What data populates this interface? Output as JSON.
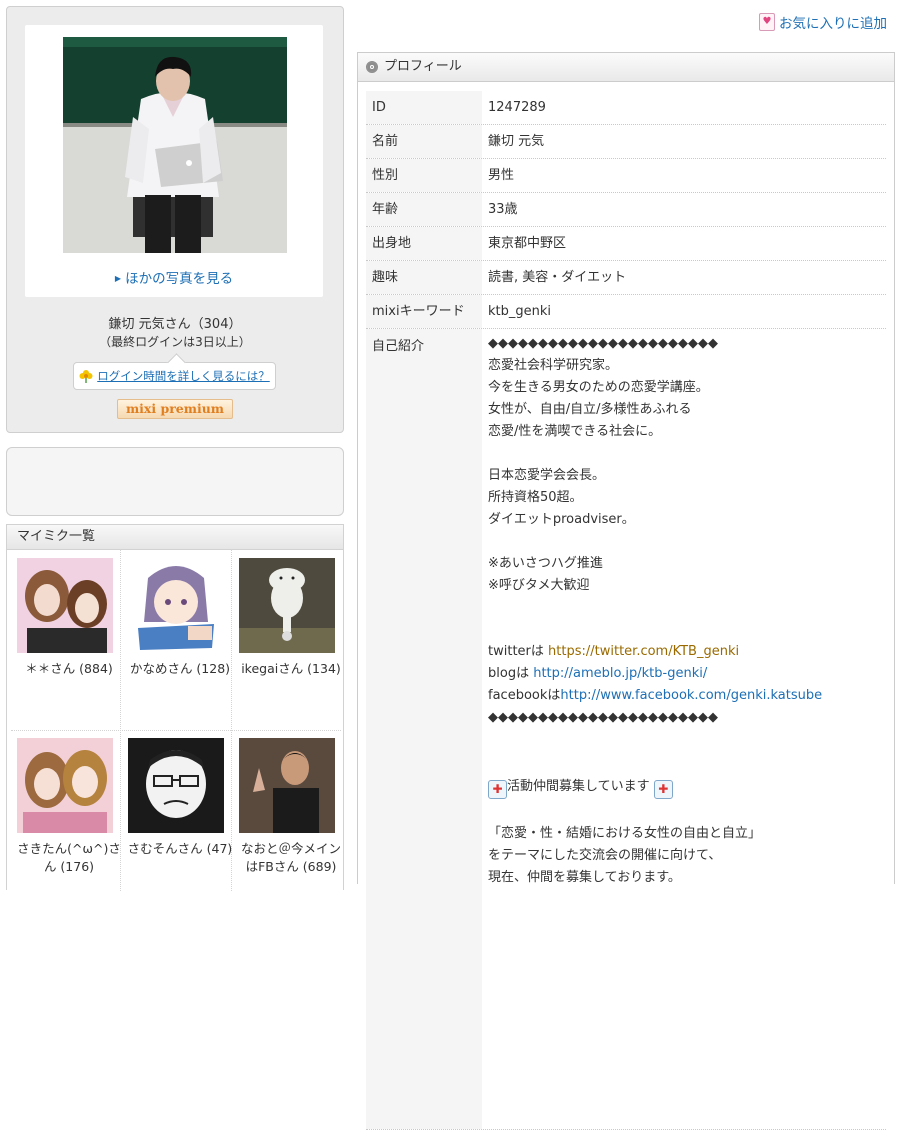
{
  "favorite": {
    "label": "お気に入りに追加",
    "icon": "heart-bookmark-icon"
  },
  "left": {
    "more_photos": "ほかの写真を見る",
    "user_name": "鎌切 元気さん（304）",
    "last_login": "（最終ログインは3日以上）",
    "login_help": "ログイン時間を詳しく見るには？",
    "premium_badge": "mixi premium"
  },
  "mymixi": {
    "title": "マイミク一覧",
    "friends": [
      {
        "name": "＊＊さん (884)",
        "avatar": "two-women-photo"
      },
      {
        "name": "かなめさん (128)",
        "avatar": "anime-girl-illustration"
      },
      {
        "name": "ikegaiさん (134)",
        "avatar": "moomin-illustration"
      },
      {
        "name": "さきたん(^ω^)さん (176)",
        "avatar": "two-girls-photo"
      },
      {
        "name": "さむそんさん (47)",
        "avatar": "cartoon-man-drawing"
      },
      {
        "name": "なおと＠今メインはFBさん (689)",
        "avatar": "man-peace-sign-photo"
      }
    ]
  },
  "profile": {
    "header": "プロフィール",
    "rows": [
      {
        "key": "ID",
        "value": "1247289"
      },
      {
        "key": "名前",
        "value": "鎌切 元気"
      },
      {
        "key": "性別",
        "value": "男性"
      },
      {
        "key": "年齢",
        "value": "33歳"
      },
      {
        "key": "出身地",
        "value": "東京都中野区"
      },
      {
        "key": "趣味",
        "value": "読書, 美容・ダイエット"
      },
      {
        "key": "mixiキーワード",
        "value": "ktb_genki"
      }
    ],
    "intro_key": "自己紹介",
    "intro": {
      "diamonds": "◆◆◆◆◆◆◆◆◆◆◆◆◆◆◆◆◆◆◆◆◆◆◆",
      "lines_a": [
        "恋愛社会科学研究家。",
        "今を生きる男女のための恋愛学講座。",
        "女性が、自由/自立/多様性あふれる",
        "恋愛/性を満喫できる社会に。"
      ],
      "lines_b": [
        "日本恋愛学会会長。",
        "所持資格50超。",
        "ダイエットproadviser。"
      ],
      "lines_c": [
        "※あいさつハグ推進",
        "※呼びタメ大歓迎"
      ],
      "twitter_label": "twitterは",
      "twitter_url": "https://twitter.com/KTB_genki",
      "blog_label": "blogは",
      "blog_url": "http://ameblo.jp/ktb-genki/",
      "facebook_label": "facebookは",
      "facebook_url": "http://www.facebook.com/genki.katsube",
      "recruit": "活動仲間募集しています",
      "lines_d": [
        "「恋愛・性・結婚における女性の自由と自立」",
        "をテーマにした交流会の開催に向けて、",
        "現在、仲間を募集しております。"
      ]
    }
  }
}
